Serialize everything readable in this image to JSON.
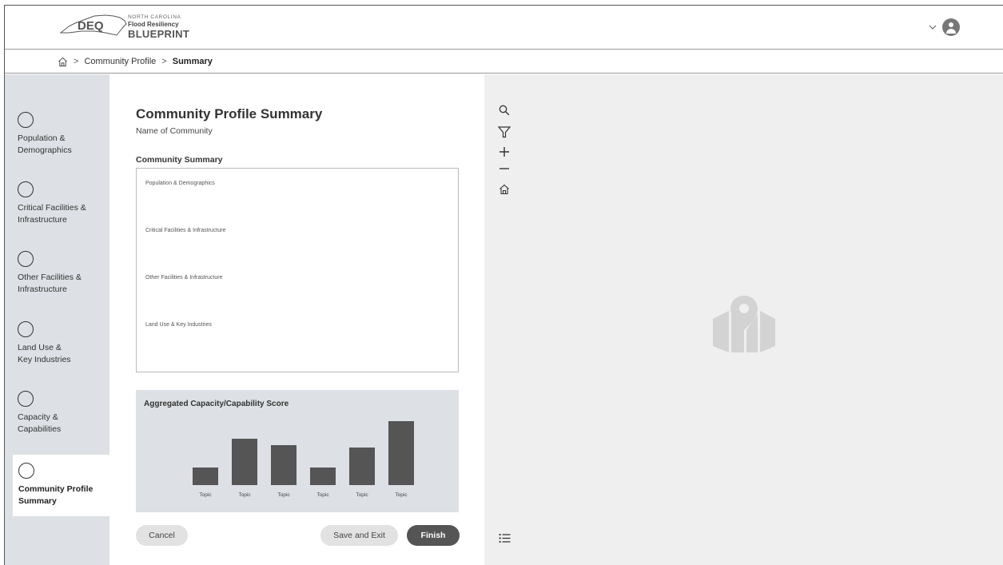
{
  "header": {
    "logo_text": "DEQ",
    "logo_line1": "NORTH CAROLINA",
    "logo_line2": "Flood Resiliency",
    "logo_line3": "BLUEPRINT"
  },
  "breadcrumb": {
    "items": [
      "Community Profile",
      "Summary"
    ]
  },
  "sidebar": {
    "items": [
      {
        "label": "Population &\nDemographics"
      },
      {
        "label": "Critical Facilities &\nInfrastructure"
      },
      {
        "label": "Other Facilities &\nInfrastructure"
      },
      {
        "label": "Land Use &\nKey Industries"
      },
      {
        "label": "Capacity &\nCapabilities"
      },
      {
        "label": "Community Profile\nSummary"
      }
    ]
  },
  "main": {
    "title": "Community Profile Summary",
    "subtitle": "Name of Community",
    "section_heading": "Community Summary",
    "summary_items": [
      "Population & Demographics",
      "Critical Facilities & Infrastructure",
      "Other Facilities & Infrastructure",
      "Land Use & Key Industries"
    ]
  },
  "score": {
    "title": "Aggregated Capacity/Capability Score"
  },
  "chart_data": {
    "type": "bar",
    "categories": [
      "Topic",
      "Topic",
      "Topic",
      "Topic",
      "Topic",
      "Topic"
    ],
    "values": [
      22,
      58,
      50,
      22,
      47,
      80
    ],
    "ylim": [
      0,
      100
    ],
    "grid": false,
    "color": "#555555"
  },
  "actions": {
    "cancel": "Cancel",
    "save_exit": "Save and Exit",
    "finish": "Finish"
  },
  "map": {
    "tools": [
      "search-icon",
      "filter-icon",
      "zoom-in-icon",
      "zoom-out-icon",
      "home-icon",
      "list-icon"
    ]
  },
  "colors": {
    "sidebar_bg": "#dde0e4",
    "map_bg": "#efefef",
    "primary_button": "#555555"
  }
}
